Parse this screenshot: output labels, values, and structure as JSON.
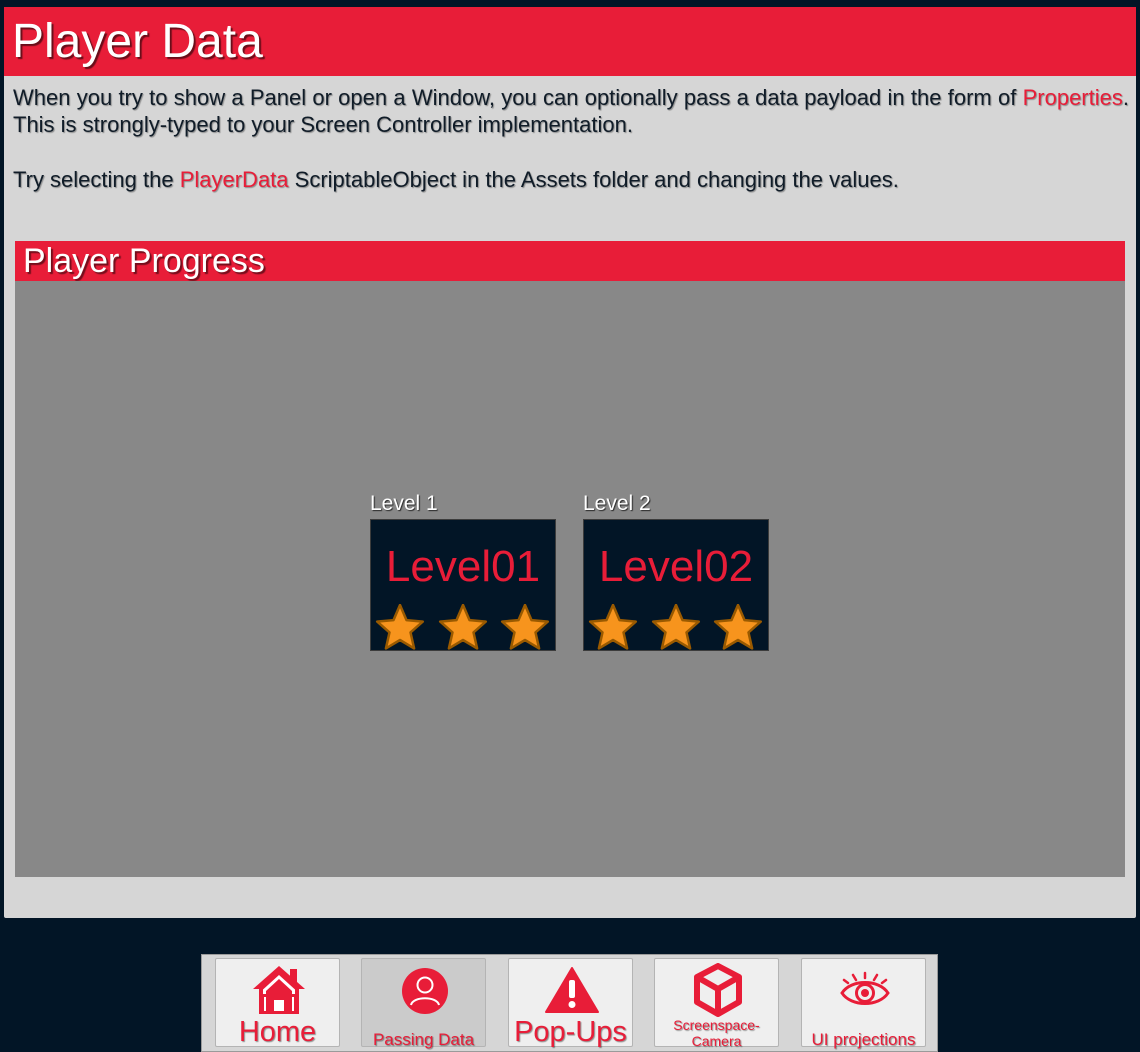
{
  "header": {
    "title": "Player Data"
  },
  "intro": {
    "line1_part1": "When you try to show a Panel or open a Window, you can optionally pass a data payload in the form of ",
    "line1_highlight": "Properties",
    "line1_part2": ". This is strongly-typed to your Screen Controller implementation.",
    "line2_part1": "Try selecting the ",
    "line2_highlight": "PlayerData",
    "line2_part2": " ScriptableObject in the Assets folder and changing the values."
  },
  "progress": {
    "title": "Player Progress",
    "levels": [
      {
        "label": "Level 1",
        "name": "Level01",
        "stars": 3,
        "max_stars": 3
      },
      {
        "label": "Level 2",
        "name": "Level02",
        "stars": 3,
        "max_stars": 3
      }
    ]
  },
  "nav": {
    "items": [
      {
        "label": "Home",
        "icon": "home-icon"
      },
      {
        "label": "Passing Data",
        "icon": "user-icon",
        "active": true
      },
      {
        "label": "Pop-Ups",
        "icon": "warning-icon"
      },
      {
        "label": "Screenspace-Camera",
        "icon": "cube-icon"
      },
      {
        "label": "UI projections",
        "icon": "eye-icon"
      }
    ]
  },
  "colors": {
    "accent": "#e81d38",
    "background": "#021526",
    "panel": "#d6d6d6",
    "progress_area": "#888888",
    "star_fill": "#f7941d",
    "star_outline": "#9a5a00"
  }
}
